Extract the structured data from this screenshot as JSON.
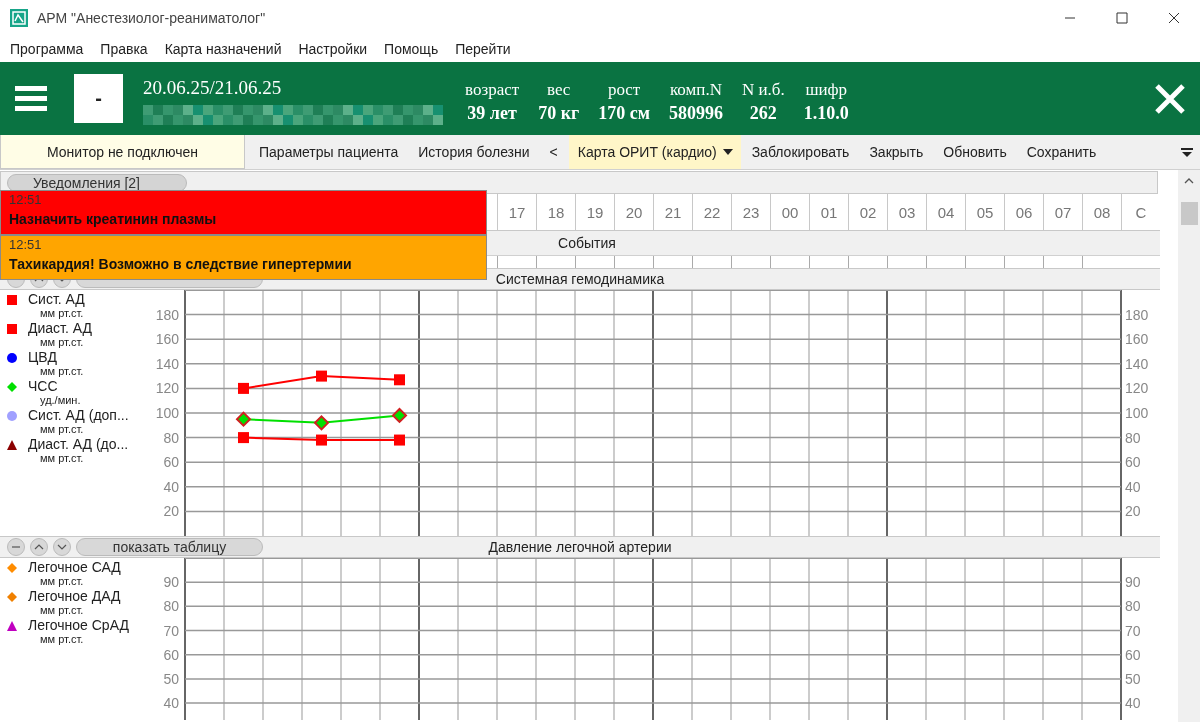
{
  "window": {
    "title": "АРМ \"Анестезиолог-реаниматолог\""
  },
  "menu": [
    "Программа",
    "Правка",
    "Карта назначений",
    "Настройки",
    "Помощь",
    "Перейти"
  ],
  "patient": {
    "photo_placeholder": "-",
    "dates": "20.06.25/21.06.25",
    "stats": [
      {
        "label": "возраст",
        "value": "39 лет"
      },
      {
        "label": "вес",
        "value": "70 кг"
      },
      {
        "label": "рост",
        "value": "170 см"
      },
      {
        "label": "комп.N",
        "value": "580996"
      },
      {
        "label": "N и.б.",
        "value": "262"
      },
      {
        "label": "шифр",
        "value": "1.10.0"
      }
    ]
  },
  "toolbar": [
    {
      "kind": "status",
      "label": "Монитор не подключен"
    },
    {
      "kind": "button",
      "label": "Параметры пациента"
    },
    {
      "kind": "button",
      "label": "История болезни"
    },
    {
      "kind": "button",
      "label": "<"
    },
    {
      "kind": "dropdown",
      "label": "Карта ОРИТ (кардио)"
    },
    {
      "kind": "button",
      "label": "Заблокировать"
    },
    {
      "kind": "button",
      "label": "Закрыть"
    },
    {
      "kind": "button",
      "label": "Обновить"
    },
    {
      "kind": "button",
      "label": "Сохранить"
    }
  ],
  "notifications": {
    "label": "Уведомления [2]",
    "items": [
      {
        "time": "12:51",
        "message": "Назначить креатинин плазмы",
        "color": "#ff0000"
      },
      {
        "time": "12:51",
        "message": "Тахикардия! Возможно в следствие гипертермии",
        "color": "#ffa500"
      }
    ]
  },
  "timeline": {
    "hours": [
      "17",
      "18",
      "19",
      "20",
      "21",
      "22",
      "23",
      "00",
      "01",
      "02",
      "03",
      "04",
      "05",
      "06",
      "07",
      "08"
    ],
    "total": "С"
  },
  "events": {
    "title": "События"
  },
  "panels": [
    {
      "title": "Системная гемодинамика",
      "units": [
        "мм рт.ст.",
        "мм рт.ст.",
        "мм рт.ст.",
        "уд./мин.",
        "мм рт.ст.",
        "мм рт.ст."
      ],
      "right_ticks": [
        "180",
        "160",
        "140",
        "120",
        "100",
        "80",
        "60",
        "40",
        "20"
      ],
      "chart_data": {
        "type": "line",
        "grid": true,
        "legend": "left",
        "categories": [
          null,
          null,
          null,
          null,
          null,
          null,
          null,
          null,
          null,
          null,
          null,
          null,
          null,
          null,
          null,
          null,
          null,
          null,
          null,
          null,
          null,
          null,
          null,
          null
        ],
        "ylim": [
          0,
          200
        ],
        "yticks": [
          20,
          40,
          60,
          80,
          100,
          120,
          140,
          160,
          180
        ],
        "series": [
          {
            "name": "Сист. АД",
            "color": "#ff0000",
            "marker": "square",
            "values": [
              null,
              120,
              null,
              130,
              null,
              127,
              null,
              null,
              null,
              null,
              null,
              null,
              null,
              null,
              null,
              null,
              null,
              null,
              null,
              null,
              null,
              null,
              null,
              null
            ]
          },
          {
            "name": "Диаст. АД",
            "color": "#ff0000",
            "marker": "square",
            "values": [
              null,
              80,
              null,
              78,
              null,
              78,
              null,
              null,
              null,
              null,
              null,
              null,
              null,
              null,
              null,
              null,
              null,
              null,
              null,
              null,
              null,
              null,
              null,
              null
            ]
          },
          {
            "name": "ЦВД",
            "color": "#0000ff",
            "marker": "circle",
            "values": [
              null,
              null,
              null,
              null,
              null,
              null,
              null,
              null,
              null,
              null,
              null,
              null,
              null,
              null,
              null,
              null,
              null,
              null,
              null,
              null,
              null,
              null,
              null,
              null
            ]
          },
          {
            "name": "ЧСС",
            "color": "#00e000",
            "marker": "diamond",
            "values": [
              null,
              95,
              null,
              92,
              null,
              98,
              null,
              null,
              null,
              null,
              null,
              null,
              null,
              null,
              null,
              null,
              null,
              null,
              null,
              null,
              null,
              null,
              null,
              null
            ]
          },
          {
            "name": "Сист. АД (доп...",
            "color": "#a0a0ff",
            "marker": "circle",
            "values": [
              null,
              null,
              null,
              null,
              null,
              null,
              null,
              null,
              null,
              null,
              null,
              null,
              null,
              null,
              null,
              null,
              null,
              null,
              null,
              null,
              null,
              null,
              null,
              null
            ]
          },
          {
            "name": "Диаст. АД (до...",
            "color": "#8b0000",
            "marker": "triangle",
            "values": [
              null,
              null,
              null,
              null,
              null,
              null,
              null,
              null,
              null,
              null,
              null,
              null,
              null,
              null,
              null,
              null,
              null,
              null,
              null,
              null,
              null,
              null,
              null,
              null
            ]
          }
        ]
      }
    },
    {
      "title": "Давление легочной артерии",
      "show_table": "показать таблицу",
      "units": [
        "мм рт.ст.",
        "мм рт.ст.",
        "мм рт.ст."
      ],
      "right_ticks": [
        "90",
        "80",
        "70",
        "60",
        "50",
        "40"
      ],
      "chart_data": {
        "type": "line",
        "grid": true,
        "legend": "left",
        "categories": [
          null,
          null,
          null,
          null,
          null,
          null,
          null,
          null,
          null,
          null,
          null,
          null,
          null,
          null,
          null,
          null,
          null,
          null,
          null,
          null,
          null,
          null,
          null,
          null
        ],
        "ylim": [
          33,
          100
        ],
        "yticks": [
          40,
          50,
          60,
          70,
          80,
          90
        ],
        "series": [
          {
            "name": "Легочное САД",
            "color": "#ff8c00",
            "marker": "diamond",
            "values": [
              null,
              null,
              null,
              null,
              null,
              null,
              null,
              null,
              null,
              null,
              null,
              null,
              null,
              null,
              null,
              null,
              null,
              null,
              null,
              null,
              null,
              null,
              null,
              null
            ]
          },
          {
            "name": "Легочное ДАД",
            "color": "#f08000",
            "marker": "diamond",
            "values": [
              null,
              null,
              null,
              null,
              null,
              null,
              null,
              null,
              null,
              null,
              null,
              null,
              null,
              null,
              null,
              null,
              null,
              null,
              null,
              null,
              null,
              null,
              null,
              null
            ]
          },
          {
            "name": "Легочное СрАД",
            "color": "#c000c0",
            "marker": "triangle",
            "values": [
              null,
              null,
              null,
              null,
              null,
              null,
              null,
              null,
              null,
              null,
              null,
              null,
              null,
              null,
              null,
              null,
              null,
              null,
              null,
              null,
              null,
              null,
              null,
              null
            ]
          }
        ]
      }
    }
  ]
}
